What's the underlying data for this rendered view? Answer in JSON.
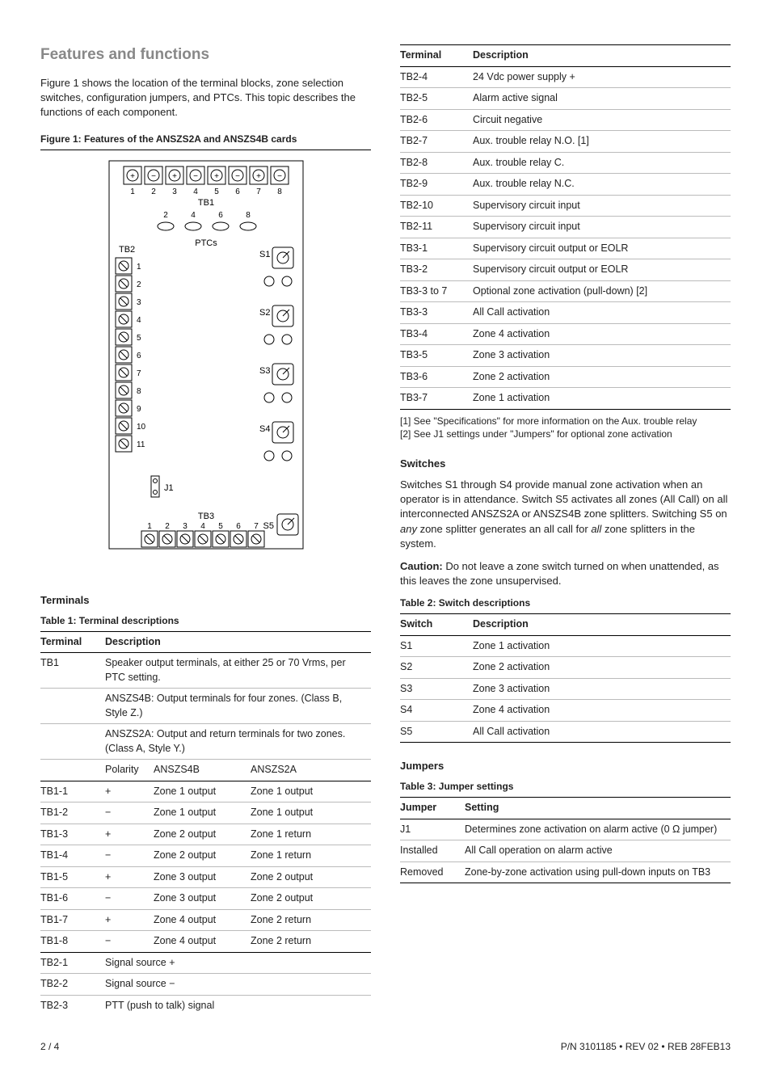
{
  "heading": "Features and functions",
  "intro": "Figure 1 shows the location of the terminal blocks, zone selection switches, configuration jumpers, and PTCs. This topic describes the functions of each component.",
  "figure1": {
    "caption": "Figure 1: Features of the ANSZS2A and ANSZS4B cards",
    "labels": {
      "tb1": "TB1",
      "tb2": "TB2",
      "tb3": "TB3",
      "ptcs": "PTCs",
      "s1": "S1",
      "s2": "S2",
      "s3": "S3",
      "s4": "S4",
      "s5": "S5",
      "j1": "J1"
    }
  },
  "terminals_heading": "Terminals",
  "table1": {
    "caption": "Table 1: Terminal descriptions",
    "head": {
      "c1": "Terminal",
      "c2": "Description"
    },
    "tb1_label": "TB1",
    "tb1_desc1": "Speaker output terminals, at either 25 or 70 Vrms, per PTC setting.",
    "tb1_desc2": "ANSZS4B: Output terminals for four zones. (Class B, Style Z.)",
    "tb1_desc3": "ANSZS2A: Output and return terminals for two zones. (Class A, Style Y.)",
    "subhead": {
      "polarity": "Polarity",
      "a4b": "ANSZS4B",
      "a2a": "ANSZS2A"
    },
    "rows_tb1": [
      {
        "t": "TB1-1",
        "p": "+",
        "b": "Zone 1 output",
        "a": "Zone 1 output"
      },
      {
        "t": "TB1-2",
        "p": "−",
        "b": "Zone 1 output",
        "a": "Zone 1 output"
      },
      {
        "t": "TB1-3",
        "p": "+",
        "b": "Zone 2 output",
        "a": "Zone 1 return"
      },
      {
        "t": "TB1-4",
        "p": "−",
        "b": "Zone 2 output",
        "a": "Zone 1 return"
      },
      {
        "t": "TB1-5",
        "p": "+",
        "b": "Zone 3 output",
        "a": "Zone 2 output"
      },
      {
        "t": "TB1-6",
        "p": "−",
        "b": "Zone 3 output",
        "a": "Zone 2 output"
      },
      {
        "t": "TB1-7",
        "p": "+",
        "b": "Zone 4 output",
        "a": "Zone 2 return"
      },
      {
        "t": "TB1-8",
        "p": "−",
        "b": "Zone 4 output",
        "a": "Zone 2 return"
      }
    ],
    "rows_simple_head": [
      {
        "t": "TB2-1",
        "d": "Signal source +"
      },
      {
        "t": "TB2-2",
        "d": "Signal source −"
      },
      {
        "t": "TB2-3",
        "d": "PTT (push to talk) signal"
      }
    ]
  },
  "table1_cont": {
    "head": {
      "c1": "Terminal",
      "c2": "Description"
    },
    "rows": [
      {
        "t": "TB2-4",
        "d": "24 Vdc power supply +"
      },
      {
        "t": "TB2-5",
        "d": "Alarm active signal"
      },
      {
        "t": "TB2-6",
        "d": "Circuit negative"
      },
      {
        "t": "TB2-7",
        "d": "Aux. trouble relay N.O. [1]"
      },
      {
        "t": "TB2-8",
        "d": "Aux. trouble relay C."
      },
      {
        "t": "TB2-9",
        "d": "Aux. trouble relay N.C."
      },
      {
        "t": "TB2-10",
        "d": "Supervisory circuit input"
      },
      {
        "t": "TB2-11",
        "d": "Supervisory circuit input"
      },
      {
        "t": "TB3-1",
        "d": "Supervisory circuit output or EOLR"
      },
      {
        "t": "TB3-2",
        "d": "Supervisory circuit output or EOLR"
      },
      {
        "t": "TB3-3 to 7",
        "d": "Optional zone activation (pull-down) [2]"
      },
      {
        "t": "TB3-3",
        "d": "All Call activation"
      },
      {
        "t": "TB3-4",
        "d": "Zone 4 activation"
      },
      {
        "t": "TB3-5",
        "d": "Zone 3 activation"
      },
      {
        "t": "TB3-6",
        "d": "Zone 2 activation"
      },
      {
        "t": "TB3-7",
        "d": "Zone 1 activation"
      }
    ],
    "note1": "[1] See \"Specifications\" for more information on the Aux. trouble relay",
    "note2": "[2] See J1 settings under \"Jumpers\" for optional zone activation"
  },
  "switches": {
    "heading": "Switches",
    "p1a": "Switches S1 through S4 provide manual zone activation when an operator is in attendance. Switch S5 activates all zones (All Call) on all interconnected ANSZS2A or ANSZS4B zone splitters. Switching S5 on ",
    "p1b": "any",
    "p1c": " zone splitter generates an all call for ",
    "p1d": "all",
    "p1e": " zone splitters in the system.",
    "caution_label": "Caution:",
    "caution_text": " Do not leave a zone switch turned on when unattended, as this leaves the zone unsupervised."
  },
  "table2": {
    "caption": "Table 2: Switch descriptions",
    "head": {
      "c1": "Switch",
      "c2": "Description"
    },
    "rows": [
      {
        "s": "S1",
        "d": "Zone 1 activation"
      },
      {
        "s": "S2",
        "d": "Zone 2 activation"
      },
      {
        "s": "S3",
        "d": "Zone 3 activation"
      },
      {
        "s": "S4",
        "d": "Zone 4 activation"
      },
      {
        "s": "S5",
        "d": "All Call activation"
      }
    ]
  },
  "jumpers_heading": "Jumpers",
  "table3": {
    "caption": "Table 3: Jumper settings",
    "head": {
      "c1": "Jumper",
      "c2": "Setting"
    },
    "rows": [
      {
        "j": "J1",
        "s": "Determines zone activation on alarm active (0 Ω jumper)"
      },
      {
        "j": "Installed",
        "s": "All Call operation on alarm active"
      },
      {
        "j": "Removed",
        "s": "Zone-by-zone activation using pull-down inputs on TB3"
      }
    ]
  },
  "footer": {
    "left": "2 / 4",
    "right": "P/N 3101185 • REV 02 • REB 28FEB13"
  }
}
